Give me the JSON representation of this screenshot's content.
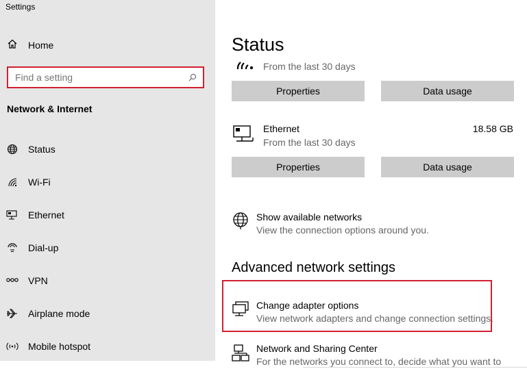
{
  "window": {
    "title": "Settings"
  },
  "sidebar": {
    "home_label": "Home",
    "search": {
      "placeholder": "Find a setting",
      "value": ""
    },
    "section_title": "Network & Internet",
    "items": [
      {
        "label": "Status",
        "icon": "globe-icon"
      },
      {
        "label": "Wi-Fi",
        "icon": "wifi-icon"
      },
      {
        "label": "Ethernet",
        "icon": "ethernet-icon"
      },
      {
        "label": "Dial-up",
        "icon": "dialup-icon"
      },
      {
        "label": "VPN",
        "icon": "vpn-icon"
      },
      {
        "label": "Airplane mode",
        "icon": "airplane-icon"
      },
      {
        "label": "Mobile hotspot",
        "icon": "hotspot-icon"
      }
    ]
  },
  "main": {
    "title": "Status",
    "wifi": {
      "subtitle": "From the last 30 days",
      "properties_label": "Properties",
      "data_usage_label": "Data usage"
    },
    "ethernet": {
      "name": "Ethernet",
      "usage": "18.58 GB",
      "subtitle": "From the last 30 days",
      "properties_label": "Properties",
      "data_usage_label": "Data usage"
    },
    "show_networks": {
      "title": "Show available networks",
      "description": "View the connection options around you."
    },
    "advanced_heading": "Advanced network settings",
    "change_adapter": {
      "title": "Change adapter options",
      "description": "View network adapters and change connection settings."
    },
    "sharing_center": {
      "title": "Network and Sharing Center",
      "description": "For the networks you connect to, decide what you want to share."
    }
  },
  "colors": {
    "sidebar_bg": "#e6e6e6",
    "button_bg": "#cccccc",
    "highlight_red": "#d0202e"
  }
}
